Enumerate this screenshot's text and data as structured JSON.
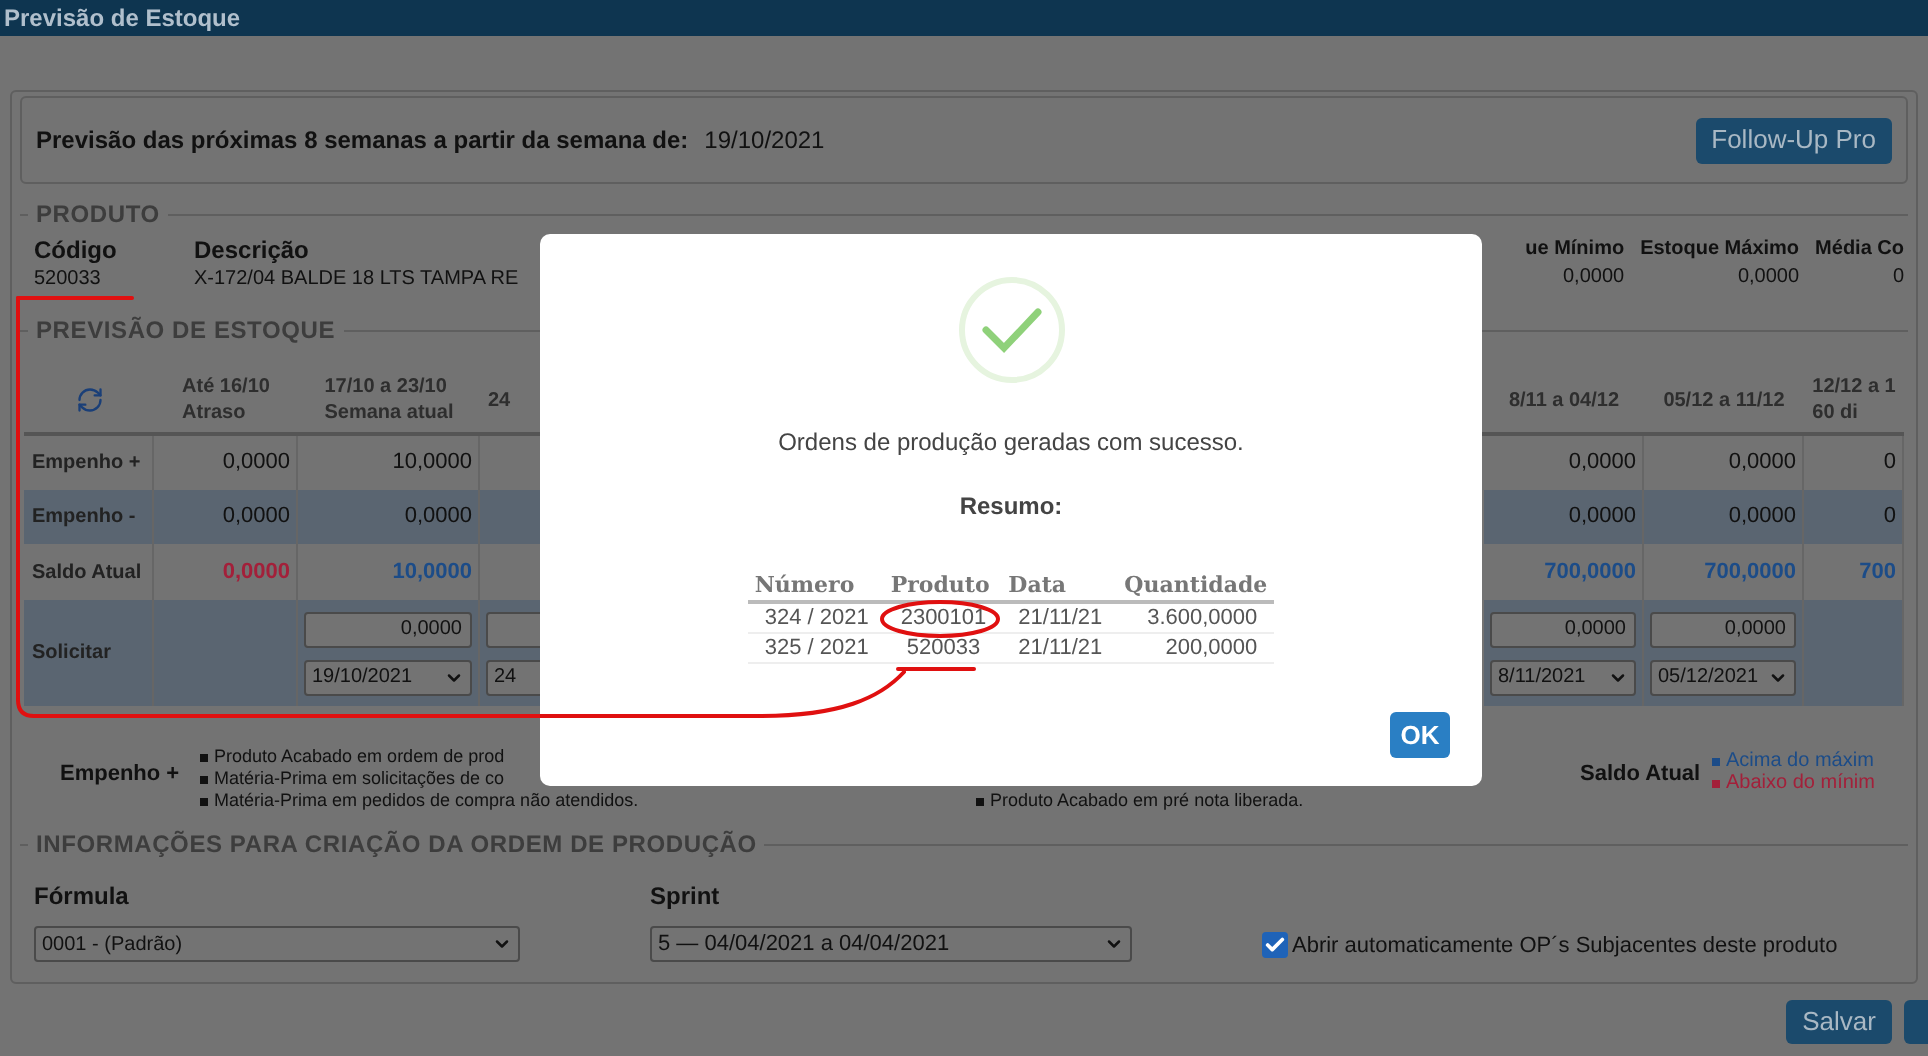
{
  "window": {
    "title": "Previsão de Estoque"
  },
  "header": {
    "label": "Previsão das próximas 8 semanas a partir da semana de:",
    "date": "19/10/2021",
    "follow_up_button": "Follow-Up Pro"
  },
  "product": {
    "legend": "PRODUTO",
    "fields": [
      {
        "label": "Código",
        "value": "520033",
        "kind": "left"
      },
      {
        "label": "Descrição",
        "value": "X-172/04 BALDE 18 LTS TAMPA RE",
        "kind": "left"
      },
      {
        "label": "ue Mínimo",
        "value": "0,0000",
        "kind": "right"
      },
      {
        "label": "Estoque Máximo",
        "value": "0,0000",
        "kind": "right"
      },
      {
        "label": "Média Co",
        "value": "0",
        "kind": "right"
      }
    ]
  },
  "forecast": {
    "legend": "PREVISÃO DE ESTOQUE",
    "row_labels": [
      "Empenho +",
      "Empenho -",
      "Saldo Atual",
      "Solicitar"
    ],
    "columns": [
      {
        "heading": [
          "Até 16/10",
          "Atraso"
        ],
        "empenho_plus": "0,0000",
        "empenho_minus": "0,0000",
        "saldo": {
          "value": "0,0000",
          "color": "#a3203a"
        }
      },
      {
        "heading": [
          "17/10 a 23/10",
          "Semana atual"
        ],
        "empenho_plus": "10,0000",
        "empenho_minus": "0,0000",
        "saldo": {
          "value": "10,0000",
          "color": "#1c4c88"
        },
        "request_qty": "0,0000",
        "request_date": "19/10/2021"
      },
      {
        "heading": [
          "24"
        ],
        "request_date": "24",
        "kind": "partial"
      },
      {
        "heading": [
          "8/11 a 04/12"
        ],
        "empenho_plus": "0,0000",
        "empenho_minus": "0,0000",
        "saldo": {
          "value": "700,0000",
          "color": "#1c4c88"
        },
        "request_qty": "0,0000",
        "request_date": "8/11/2021"
      },
      {
        "heading": [
          "05/12 a 11/12"
        ],
        "empenho_plus": "0,0000",
        "empenho_minus": "0,0000",
        "saldo": {
          "value": "700,0000",
          "color": "#1c4c88"
        },
        "request_qty": "0,0000",
        "request_date": "05/12/2021"
      },
      {
        "heading": [
          "12/12 a 1",
          "60 di"
        ],
        "empenho_plus": "0",
        "empenho_minus": "0",
        "saldo": {
          "value": "700",
          "color": "#1c4c88"
        }
      }
    ],
    "legend_left": {
      "label": "Empenho +",
      "items": [
        "Produto Acabado em ordem de prod",
        "Matéria-Prima em solicitações de co",
        "Matéria-Prima em pedidos de compra não atendidos."
      ]
    },
    "legend_middle": {
      "items": [
        "Produto Acabado em pré nota liberada."
      ]
    },
    "legend_right": {
      "label": "Saldo Atual",
      "items": [
        {
          "text": "Acima do máxim",
          "color": "#1c4c88"
        },
        {
          "text": "Abaixo do mínim",
          "color": "#a3203a"
        }
      ]
    }
  },
  "production_info": {
    "legend": "INFORMAÇÕES PARA CRIAÇÃO DA ORDEM DE PRODUÇÃO",
    "formula": {
      "label": "Fórmula",
      "value": "0001 - (Padrão)"
    },
    "sprint": {
      "label": "Sprint",
      "value": "5 — 04/04/2021 a 04/04/2021"
    },
    "auto_open": {
      "label": "Abrir automaticamente OP´s Subjacentes deste produto",
      "checked": true
    }
  },
  "buttons": [
    "Salvar"
  ],
  "dialog": {
    "message": "Ordens de produção geradas com sucesso.",
    "summary_label": "Resumo:",
    "columns": [
      "Número",
      "Produto",
      "Data",
      "Quantidade"
    ],
    "rows": [
      [
        "324 / 2021",
        "2300101",
        "21/11/21",
        "3.600,0000"
      ],
      [
        "325 / 2021",
        "520033",
        "21/11/21",
        "200,0000"
      ]
    ],
    "ok_button": "OK"
  }
}
